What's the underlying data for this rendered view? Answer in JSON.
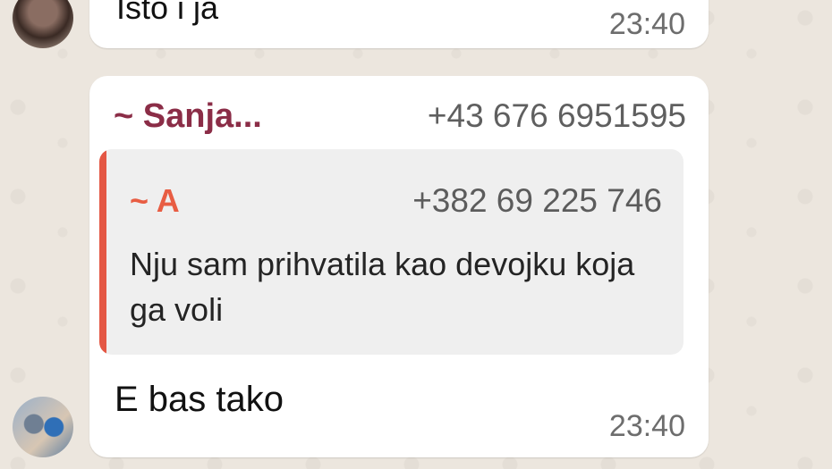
{
  "conversation": {
    "top_message": {
      "text": "Isto i ja",
      "time": "23:40"
    },
    "main_message": {
      "sender": {
        "name": "~ Sanja...",
        "phone": "+43 676 6951595",
        "color": "#8b2d47"
      },
      "quoted": {
        "sender_name": "~ A",
        "sender_phone": "+382 69 225 746",
        "text": "Nju sam prihvatila kao devojku koja ga voli",
        "accent_color": "#e45744"
      },
      "text": "E bas tako",
      "time": "23:40"
    }
  }
}
